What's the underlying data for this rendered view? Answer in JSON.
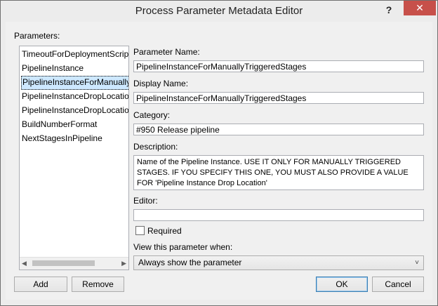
{
  "window": {
    "title": "Process Parameter Metadata Editor",
    "help_glyph": "?",
    "close_glyph": "✕"
  },
  "parameters": {
    "label": "Parameters:",
    "items": [
      "TimeoutForDeploymentScript",
      "PipelineInstance",
      "PipelineInstanceForManuallyTriggeredStages",
      "PipelineInstanceDropLocation",
      "PipelineInstanceDropLocation",
      "BuildNumberFormat",
      "NextStagesInPipeline"
    ],
    "selected_index": 2
  },
  "form": {
    "parameter_name_label": "Parameter Name:",
    "parameter_name_value": "PipelineInstanceForManuallyTriggeredStages",
    "display_name_label": "Display Name:",
    "display_name_value": "PipelineInstanceForManuallyTriggeredStages",
    "category_label": "Category:",
    "category_value": "#950 Release pipeline",
    "description_label": "Description:",
    "description_value": "Name of the Pipeline Instance. USE IT ONLY FOR MANUALLY TRIGGERED STAGES. IF YOU SPECIFY THIS ONE, YOU MUST ALSO PROVIDE A VALUE FOR 'Pipeline Instance Drop Location'",
    "editor_label": "Editor:",
    "editor_value": "",
    "required_label": "Required",
    "required_checked": false,
    "view_when_label": "View this parameter when:",
    "view_when_value": "Always show the parameter"
  },
  "buttons": {
    "add": "Add",
    "remove": "Remove",
    "ok": "OK",
    "cancel": "Cancel"
  }
}
